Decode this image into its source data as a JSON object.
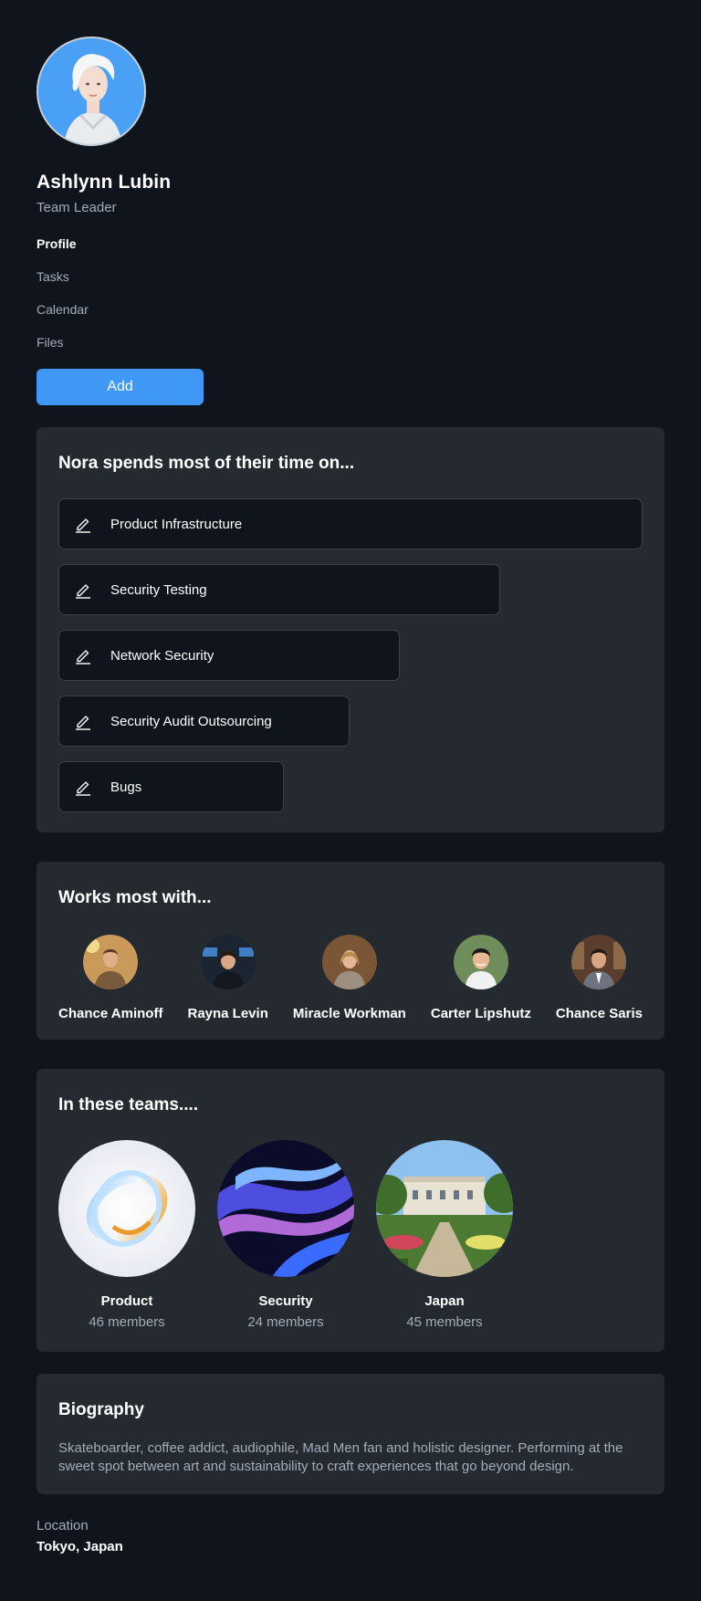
{
  "profile": {
    "name": "Ashlynn Lubin",
    "role": "Team Leader"
  },
  "nav": {
    "items": [
      {
        "label": "Profile",
        "active": true
      },
      {
        "label": "Tasks",
        "active": false
      },
      {
        "label": "Calendar",
        "active": false
      },
      {
        "label": "Files",
        "active": false
      }
    ]
  },
  "add_button": {
    "label": "Add"
  },
  "time_section": {
    "title": "Nora spends most of their time on...",
    "items": [
      {
        "label": "Product Infrastructure",
        "icon": "pencil-icon"
      },
      {
        "label": "Security Testing",
        "icon": "pencil-icon"
      },
      {
        "label": "Network Security",
        "icon": "pencil-icon"
      },
      {
        "label": "Security Audit Outsourcing",
        "icon": "pencil-icon"
      },
      {
        "label": "Bugs",
        "icon": "pencil-icon"
      }
    ]
  },
  "works_section": {
    "title": "Works most with...",
    "people": [
      {
        "name": "Chance Aminoff"
      },
      {
        "name": "Rayna Levin"
      },
      {
        "name": "Miracle Workman"
      },
      {
        "name": "Carter Lipshutz"
      },
      {
        "name": "Chance Saris"
      }
    ]
  },
  "teams_section": {
    "title": "In these teams....",
    "teams": [
      {
        "name": "Product",
        "members": "46 members"
      },
      {
        "name": "Security",
        "members": "24 members"
      },
      {
        "name": "Japan",
        "members": "45 members"
      }
    ]
  },
  "biography": {
    "title": "Biography",
    "text": "Skateboarder, coffee addict, audiophile, Mad Men fan and holistic designer. Performing at the sweet spot between art and sustainability to craft experiences that go beyond design."
  },
  "location": {
    "label": "Location",
    "value": "Tokyo, Japan"
  },
  "colors": {
    "background": "#10141c",
    "card": "#252a31",
    "accent": "#3f97f6",
    "muted_text": "#a3acb8"
  }
}
